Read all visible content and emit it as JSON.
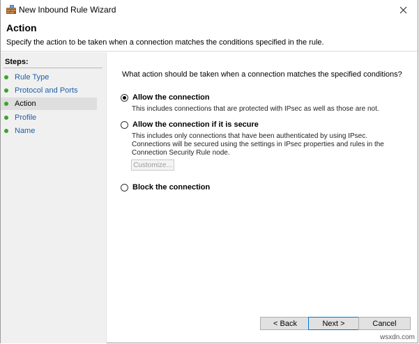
{
  "window": {
    "title": "New Inbound Rule Wizard"
  },
  "header": {
    "title": "Action",
    "description": "Specify the action to be taken when a connection matches the conditions specified in the rule."
  },
  "steps": {
    "label": "Steps:",
    "items": [
      {
        "label": "Rule Type"
      },
      {
        "label": "Protocol and Ports"
      },
      {
        "label": "Action",
        "current": true
      },
      {
        "label": "Profile"
      },
      {
        "label": "Name"
      }
    ]
  },
  "content": {
    "question": "What action should be taken when a connection matches the specified conditions?",
    "options": [
      {
        "label": "Allow the connection",
        "description": "This includes connections that are protected with IPsec as well as those are not.",
        "checked": true
      },
      {
        "label": "Allow the connection if it is secure",
        "description": "This includes only connections that have been authenticated by using IPsec.  Connections will be secured using the settings in IPsec properties and rules in the Connection Security Rule node.",
        "checked": false
      },
      {
        "label": "Block the connection",
        "checked": false
      }
    ],
    "customize_label": "Customize..."
  },
  "buttons": {
    "back": "< Back",
    "next": "Next >",
    "cancel": "Cancel"
  },
  "watermark": "wsxdn.com",
  "colors": {
    "step_dot": "#3aa32b",
    "step_link": "#1d5fa8",
    "default_button_border": "#0078d7"
  }
}
